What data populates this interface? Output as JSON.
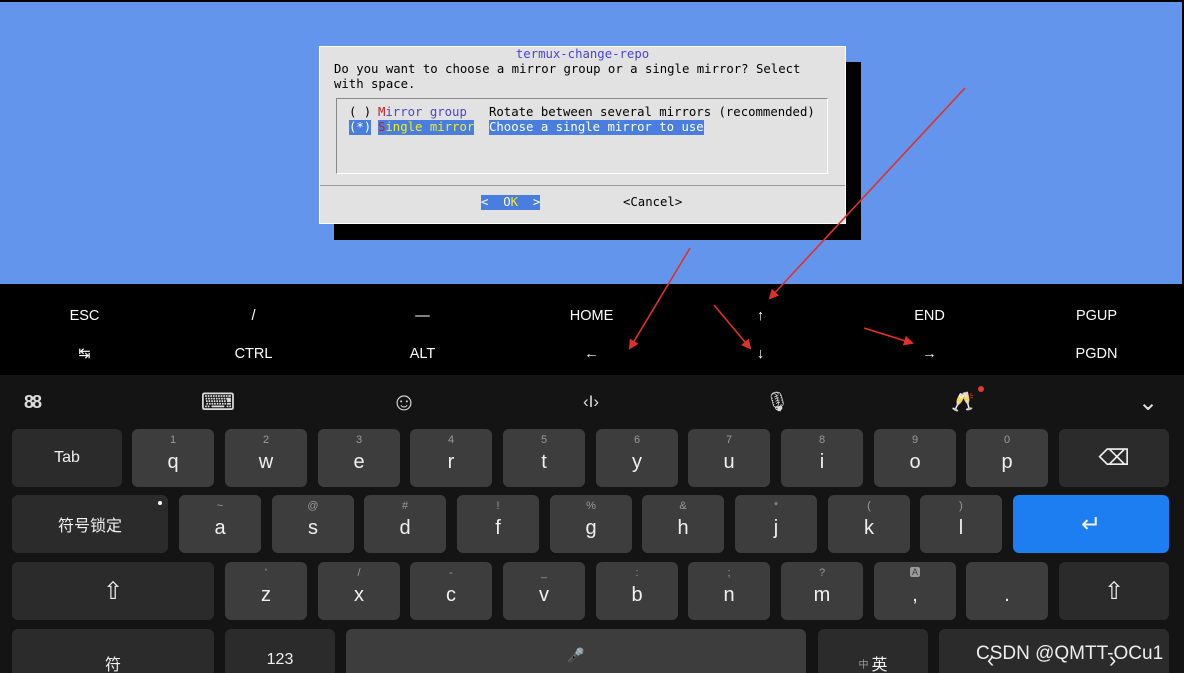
{
  "terminal": {
    "dialog": {
      "title": "termux-change-repo",
      "question_line1": "Do you want to choose a mirror group or a single mirror? Select",
      "question_line2": "with space.",
      "options": [
        {
          "radio": "( )",
          "hot": "M",
          "rest": "irror group",
          "desc": "Rotate between several mirrors (recommended)",
          "selected": false
        },
        {
          "radio": "(*)",
          "hot": "S",
          "rest": "ingle mirror",
          "desc": "Choose a single mirror to use",
          "selected": true
        }
      ],
      "ok": {
        "left": "<  ",
        "pre": "O",
        "hot": "K",
        "right": "  >"
      },
      "cancel": "<Cancel>"
    }
  },
  "extra_keys": {
    "row1": [
      "ESC",
      "/",
      "—",
      "HOME",
      "↑",
      "END",
      "PGUP"
    ],
    "row2": [
      "↹",
      "CTRL",
      "ALT",
      "←",
      "↓",
      "→",
      "PGDN"
    ]
  },
  "keyboard": {
    "toolbar": [
      {
        "name": "grid-icon",
        "glyph": "88"
      },
      {
        "name": "keyboard-icon",
        "glyph": "⌨"
      },
      {
        "name": "emoji-icon",
        "glyph": "☺"
      },
      {
        "name": "cursor-icon",
        "glyph": "‹I›"
      },
      {
        "name": "mic-icon",
        "glyph": "🎙"
      },
      {
        "name": "cheers-icon",
        "glyph": "🥂"
      },
      {
        "name": "collapse-chevron-icon",
        "glyph": "⌄"
      }
    ],
    "tab_label": "Tab",
    "caps_label": "符号锁定",
    "row1": [
      {
        "l": "q",
        "h": "1"
      },
      {
        "l": "w",
        "h": "2"
      },
      {
        "l": "e",
        "h": "3"
      },
      {
        "l": "r",
        "h": "4"
      },
      {
        "l": "t",
        "h": "5"
      },
      {
        "l": "y",
        "h": "6"
      },
      {
        "l": "u",
        "h": "7"
      },
      {
        "l": "i",
        "h": "8"
      },
      {
        "l": "o",
        "h": "9"
      },
      {
        "l": "p",
        "h": "0"
      }
    ],
    "row2": [
      {
        "l": "a",
        "h": "~"
      },
      {
        "l": "s",
        "h": "@"
      },
      {
        "l": "d",
        "h": "#"
      },
      {
        "l": "f",
        "h": "!"
      },
      {
        "l": "g",
        "h": "%"
      },
      {
        "l": "h",
        "h": "&"
      },
      {
        "l": "j",
        "h": "*"
      },
      {
        "l": "k",
        "h": "("
      },
      {
        "l": "l",
        "h": ")"
      }
    ],
    "row3": [
      {
        "l": "z",
        "h": "'"
      },
      {
        "l": "x",
        "h": "/"
      },
      {
        "l": "c",
        "h": "-"
      },
      {
        "l": "v",
        "h": "_"
      },
      {
        "l": "b",
        "h": ":"
      },
      {
        "l": "n",
        "h": ";"
      },
      {
        "l": "m",
        "h": "?"
      },
      {
        "l": ",",
        "h": "A"
      },
      {
        "l": ".",
        "h": ""
      }
    ],
    "backspace_glyph": "⌫",
    "enter_glyph": "↵",
    "shift_glyph": "⇧",
    "symbol_label": "符",
    "num_label": "123",
    "space_glyph": "🎤",
    "lang_small": "中",
    "lang_label": "英",
    "left_glyph": "‹",
    "right_glyph": "›"
  },
  "watermark": "CSDN @QMTT-OCu1",
  "colors": {
    "terminal_bg": "#6495ed",
    "dialog_bg": "#e2e2e2",
    "dialog_title": "#4a43d4",
    "highlight": "#4a7ede",
    "hotkey_red": "#c81919",
    "hotkey_yellow": "#f2ee19",
    "enter_key": "#1c7ef0",
    "arrow_annotation": "#e0302a"
  }
}
